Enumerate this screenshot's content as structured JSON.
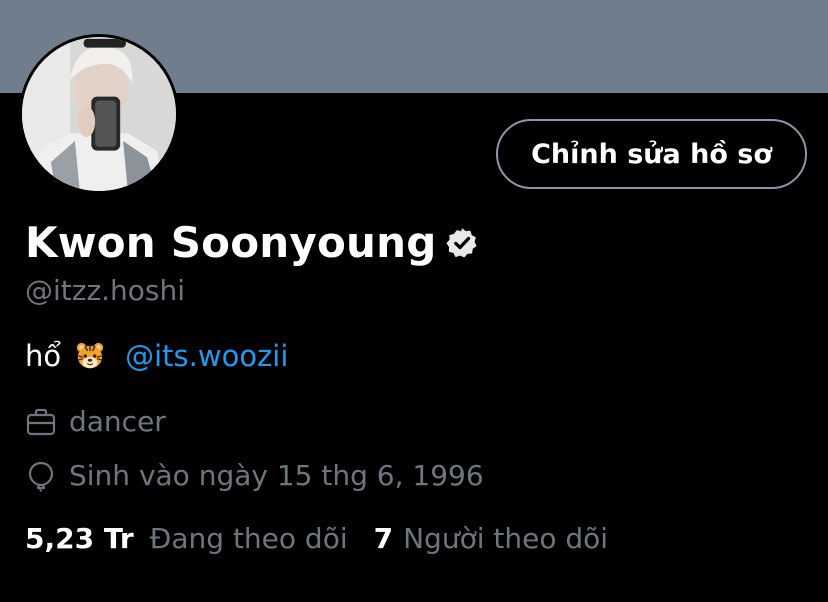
{
  "profile": {
    "name": "Kwon Soonyoung",
    "handle": "@itzz.hoshi",
    "edit_button_label": "Chỉnh sửa hồ sơ",
    "bio_text": "hổ",
    "bio_emoji": "tiger-face",
    "bio_mention": "@its.woozii",
    "job": "dancer",
    "birthday": "Sinh vào ngày 15 thg 6, 1996",
    "following_count": "5,23 Tr",
    "following_label": "Đang theo dõi",
    "followers_count": "7",
    "followers_label": "Người theo dõi"
  },
  "colors": {
    "background": "#000000",
    "banner": "#707d8c",
    "muted_text": "#6e767d",
    "link": "#1d9bf0",
    "button_border": "#8b98a5"
  },
  "icons": {
    "verified": "verified-badge-icon",
    "job": "briefcase-icon",
    "birthday": "balloon-icon"
  }
}
